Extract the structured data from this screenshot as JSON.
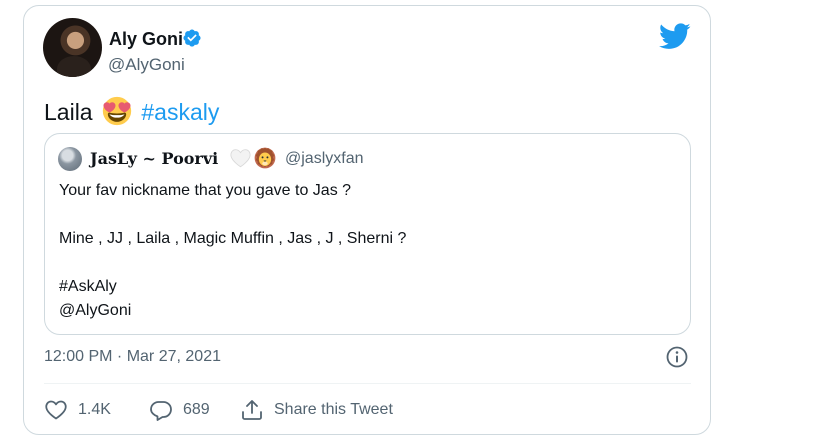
{
  "tweet": {
    "author": {
      "name": "Aly Goni",
      "handle": "@AlyGoni",
      "verified": true
    },
    "text_before_emoji": "Laila",
    "emoji": "heart-eyes-emoji",
    "hashtag": "#askaly",
    "timestamp": "12:00 PM · Mar 27, 2021",
    "stats": {
      "likes": "1.4K",
      "replies": "689",
      "share_label": "Share this Tweet"
    }
  },
  "quoted_tweet": {
    "author_name": "JasLy ~ Poorvi",
    "author_name_icons": [
      "white-heart-icon",
      "lion-icon"
    ],
    "handle": "@jaslyxfan",
    "lines": [
      "Your fav nickname that you gave to Jas ?",
      "",
      "Mine , JJ , Laila , Magic Muffin , Jas , J , Sherni ?",
      "",
      "#AskAly",
      "@AlyGoni"
    ]
  },
  "colors": {
    "accent": "#1d9bf0",
    "text_primary": "#0f1419",
    "text_secondary": "#536471",
    "border": "#cfd9de"
  }
}
